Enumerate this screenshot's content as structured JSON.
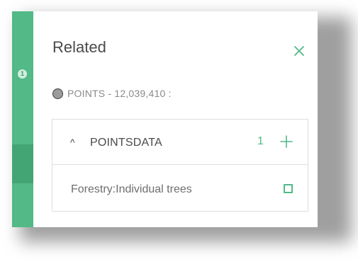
{
  "rail": {
    "step_number": "1",
    "color": "#52b987",
    "active_color": "#43a574"
  },
  "panel": {
    "title": "Related",
    "close_icon": "close-icon",
    "layer": {
      "name": "POINTS - 12,039,410 :",
      "swatch_color": "#9b9b9b"
    },
    "related_table": {
      "name": "POINTSDATA",
      "count": "1",
      "expanded": true,
      "caret_icon": "chevron-up-icon",
      "add_icon": "plus-icon",
      "features": [
        {
          "label": "Forestry:Individual trees",
          "checked": false
        }
      ]
    }
  },
  "colors": {
    "accent": "#52b987",
    "text": "#4a4a4a",
    "muted_text": "#8a8a8a",
    "border": "#dedede"
  }
}
